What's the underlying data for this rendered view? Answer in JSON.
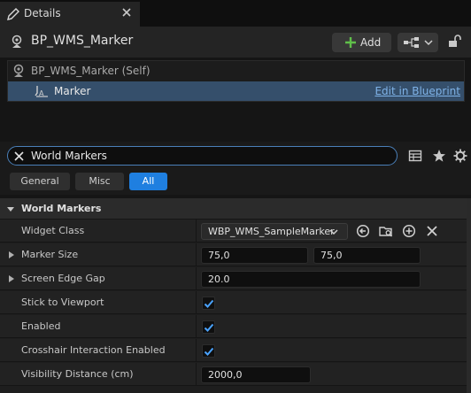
{
  "tab": {
    "title": "Details",
    "icon": "pencil-icon",
    "close_icon": "close-icon"
  },
  "header": {
    "actor_name": "BP_WMS_Marker",
    "actor_icon": "actor-icon",
    "add_label": "Add",
    "add_icon": "plus-icon",
    "blueprint_icon": "blueprint-icon",
    "lock_icon": "lock-icon"
  },
  "tree": {
    "self_label": "BP_WMS_Marker (Self)",
    "selected_label": "Marker",
    "edit_link": "Edit in Blueprint"
  },
  "search": {
    "value": "World Markers",
    "clear_icon": "close-icon"
  },
  "toolbar_icons": [
    "table-icon",
    "star-icon",
    "gear-icon"
  ],
  "filters": [
    {
      "label": "General",
      "active": false
    },
    {
      "label": "Misc",
      "active": false
    },
    {
      "label": "All",
      "active": true
    }
  ],
  "category": {
    "label": "World Markers"
  },
  "properties": {
    "widget_class": {
      "name": "Widget Class",
      "value": "WBP_WMS_SampleMarker"
    },
    "marker_size": {
      "name": "Marker Size",
      "x": "75,0",
      "y": "75,0"
    },
    "screen_edge_gap": {
      "name": "Screen Edge Gap",
      "value": "20.0"
    },
    "stick_to_viewport": {
      "name": "Stick to Viewport",
      "checked": true
    },
    "enabled": {
      "name": "Enabled",
      "checked": true
    },
    "crosshair": {
      "name": "Crosshair Interaction Enabled",
      "checked": true
    },
    "visibility": {
      "name": "Visibility Distance (cm)",
      "value": "2000,0"
    }
  },
  "colors": {
    "accent": "#1f7fe0",
    "selection": "#354f6b",
    "link": "#7fb3e8",
    "add_green": "#5fbf4a"
  }
}
